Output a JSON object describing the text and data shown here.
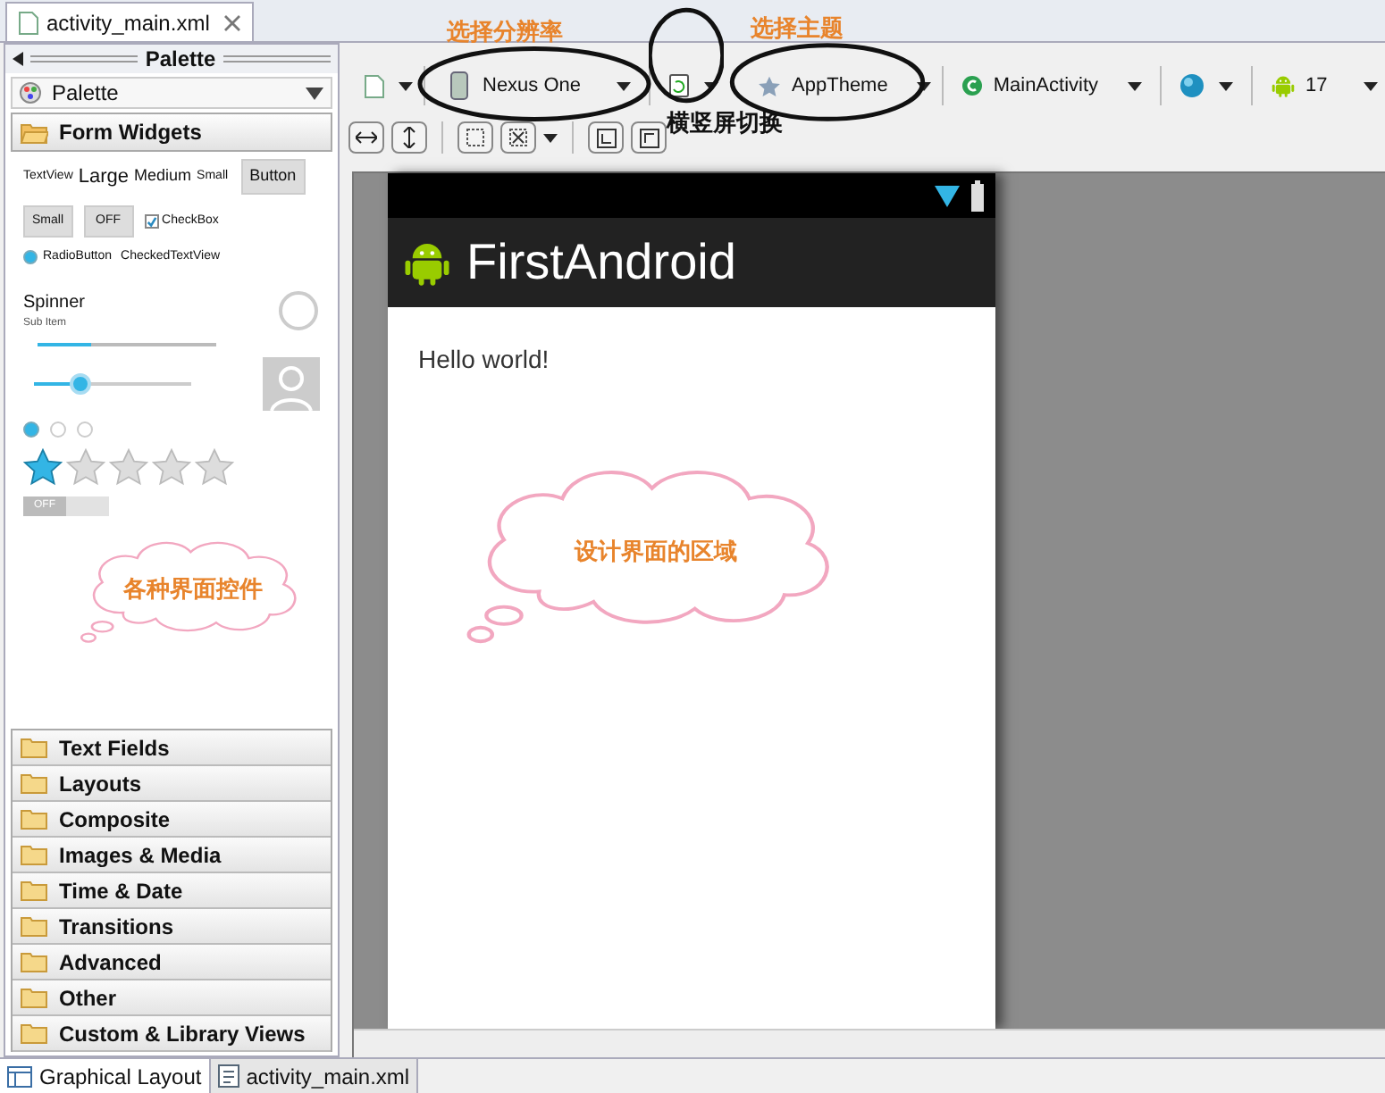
{
  "editor_tab": {
    "label": "activity_main.xml"
  },
  "palette": {
    "title": "Palette",
    "selector": "Palette",
    "expanded_category": {
      "label": "Form Widgets",
      "expanded": true
    },
    "widgets": {
      "text_views": [
        "TextView",
        "Large",
        "Medium",
        "Small"
      ],
      "button": "Button",
      "small_button": "Small",
      "toggle": "OFF",
      "checkbox": {
        "label": "CheckBox",
        "checked": true
      },
      "radio": {
        "label": "RadioButton",
        "selected": true
      },
      "checked_text_view": "CheckedTextView",
      "spinner": {
        "title": "Spinner",
        "subtitle": "Sub Item"
      },
      "progress": {
        "level": 0.3
      },
      "seekbar": {
        "level": 0.3
      },
      "radio_group": [
        {
          "selected": true
        },
        {
          "selected": false
        },
        {
          "selected": false
        }
      ],
      "rating": {
        "stars": 1
      },
      "switch": {
        "label": "OFF",
        "on": false
      }
    },
    "categories": [
      {
        "label": "Text Fields",
        "expanded": false
      },
      {
        "label": "Layouts",
        "expanded": false
      },
      {
        "label": "Composite",
        "expanded": false
      },
      {
        "label": "Images & Media",
        "expanded": false
      },
      {
        "label": "Time & Date",
        "expanded": false
      },
      {
        "label": "Transitions",
        "expanded": false
      },
      {
        "label": "Advanced",
        "expanded": false
      },
      {
        "label": "Other",
        "expanded": false
      },
      {
        "label": "Custom & Library Views",
        "expanded": false
      }
    ]
  },
  "toolbar": {
    "device": "Nexus One",
    "theme": "AppTheme",
    "activity": "MainActivity",
    "api_level": "17"
  },
  "preview": {
    "app_title": "FirstAndroid",
    "content": "Hello world!"
  },
  "annotations": {
    "device": "选择分辨率",
    "theme": "选择主题",
    "orientation": "横竖屏切换",
    "widgets": "各种界面控件",
    "canvas": "设计界面的区域"
  },
  "bottom_tabs": [
    {
      "label": "Graphical Layout",
      "selected": true
    },
    {
      "label": "activity_main.xml",
      "selected": false
    }
  ]
}
